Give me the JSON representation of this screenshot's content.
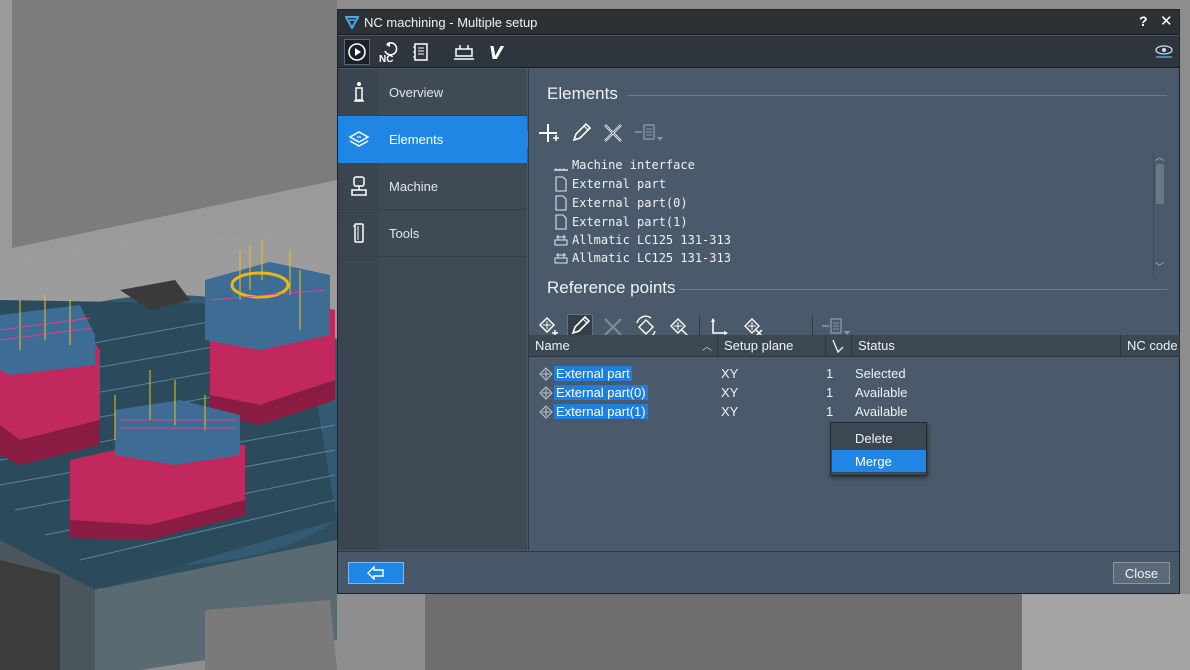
{
  "window": {
    "title": "NC machining - Multiple setup",
    "help_label": "?",
    "close_label": "✕"
  },
  "toolbar": {
    "buttons": [
      {
        "name": "simulate-play-icon",
        "active": true
      },
      {
        "name": "nc-regenerate-icon",
        "label": "NC"
      },
      {
        "name": "nc-report-icon"
      },
      {
        "name": "setup-machine-icon"
      },
      {
        "name": "verify-icon",
        "label": "V"
      },
      {
        "name": "visibility-eye-icon"
      }
    ]
  },
  "sidenav": {
    "items": [
      {
        "label": "Overview",
        "icon": "info-icon",
        "active": false
      },
      {
        "label": "Elements",
        "icon": "elements-stack-icon",
        "active": true
      },
      {
        "label": "Machine",
        "icon": "machine-icon",
        "active": false
      },
      {
        "label": "Tools",
        "icon": "tools-icon",
        "active": false
      }
    ]
  },
  "elements": {
    "heading": "Elements",
    "tree": [
      {
        "label": "Machine interface",
        "icon": "machine-interface-icon"
      },
      {
        "label": "External part",
        "icon": "document-icon"
      },
      {
        "label": "External part(0)",
        "icon": "document-icon"
      },
      {
        "label": "External part(1)",
        "icon": "document-icon"
      },
      {
        "label": "Allmatic LC125 131-313",
        "icon": "vise-icon"
      },
      {
        "label": "Allmatic LC125 131-313",
        "icon": "vise-icon"
      }
    ]
  },
  "reference_points": {
    "heading": "Reference points",
    "columns": {
      "name": "Name",
      "setup_plane": "Setup plane",
      "count": "",
      "status": "Status",
      "nc_code": "NC code"
    },
    "rows": [
      {
        "name": "External part",
        "setup_plane": "XY",
        "count": "1",
        "status": "Selected"
      },
      {
        "name": "External part(0)",
        "setup_plane": "XY",
        "count": "1",
        "status": "Available"
      },
      {
        "name": "External part(1)",
        "setup_plane": "XY",
        "count": "1",
        "status": "Available"
      }
    ]
  },
  "context_menu": {
    "items": [
      {
        "label": "Delete",
        "hover": false
      },
      {
        "label": "Merge",
        "hover": true
      }
    ]
  },
  "footer": {
    "close_label": "Close"
  },
  "colors": {
    "accent": "#1f86e6",
    "dialog_bg": "#485868",
    "titlebar_bg": "#2c3136"
  }
}
